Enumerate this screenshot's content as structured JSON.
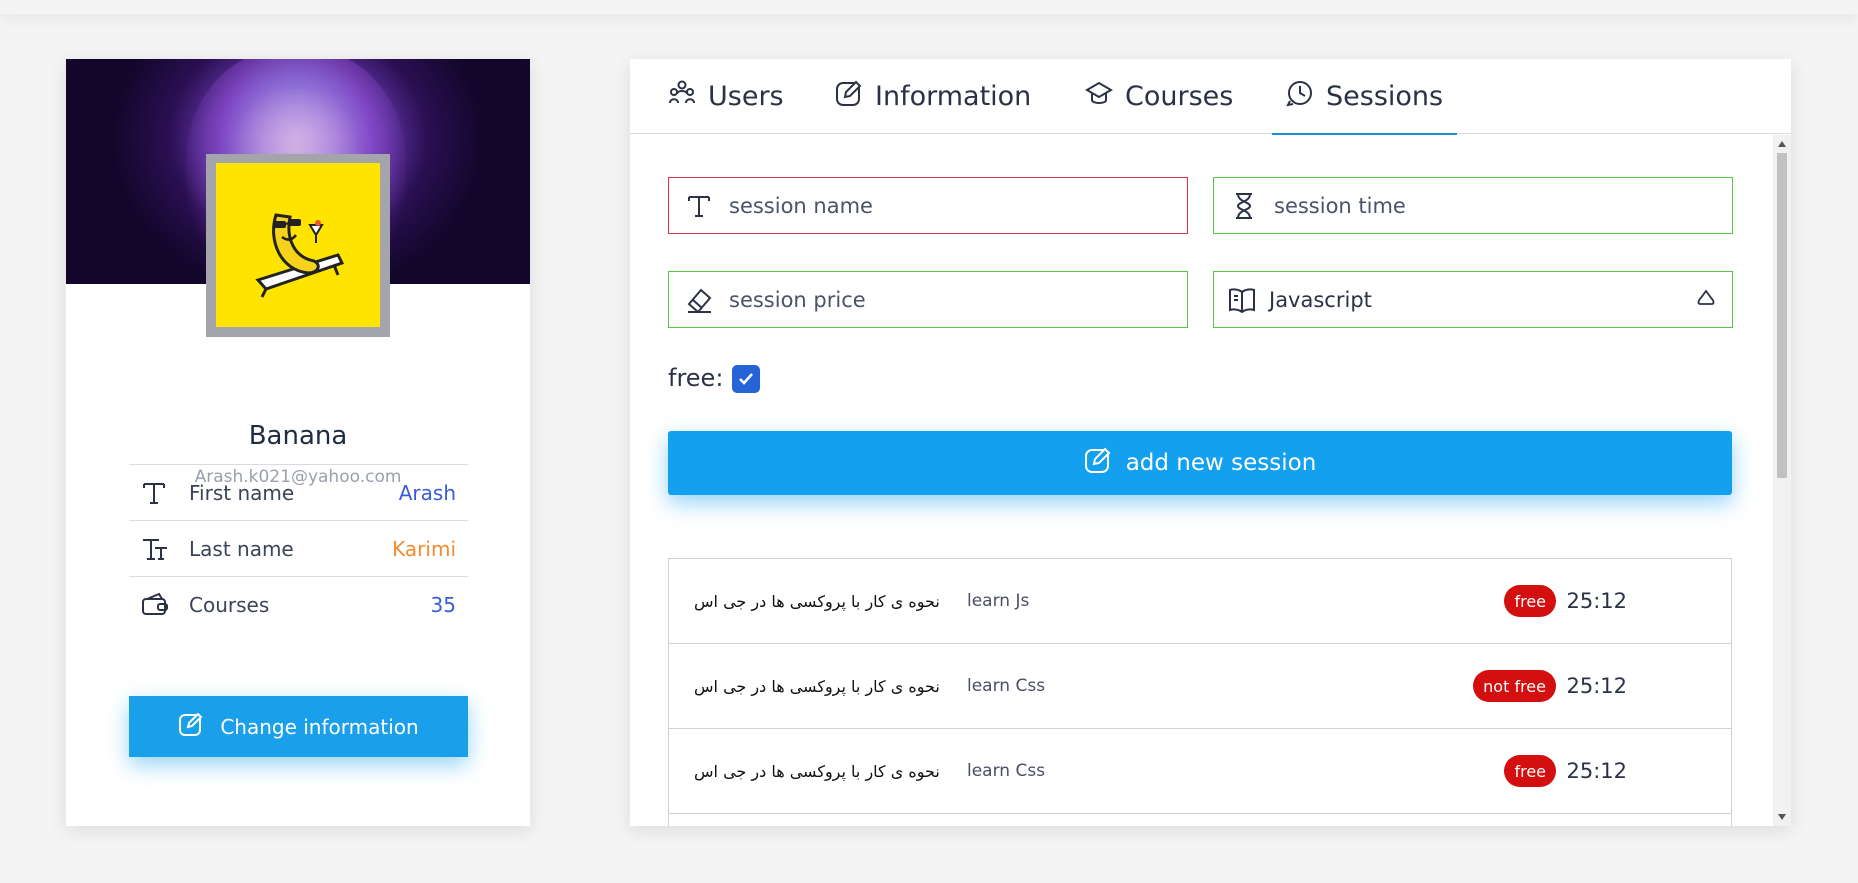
{
  "profile": {
    "name": "Banana",
    "email": "Arash.k021@yahoo.com",
    "fields": [
      {
        "icon": "text-icon",
        "label": "First name",
        "value": "Arash",
        "color": "#3b5bdb"
      },
      {
        "icon": "text-height-icon",
        "label": "Last name",
        "value": "Karimi",
        "color": "#f58b2e"
      },
      {
        "icon": "wallet-icon",
        "label": "Courses",
        "value": "35",
        "color": "#3b5bdb"
      }
    ],
    "change_button": "Change information"
  },
  "tabs": [
    {
      "icon": "users-icon",
      "label": "Users"
    },
    {
      "icon": "edit-icon",
      "label": "Information"
    },
    {
      "icon": "graduation-cap-icon",
      "label": "Courses"
    },
    {
      "icon": "session-icon",
      "label": "Sessions",
      "active": true
    }
  ],
  "form": {
    "session_name_placeholder": "session name",
    "session_time_placeholder": "session time",
    "session_price_placeholder": "session price",
    "course_select": "Javascript",
    "free_label": "free:",
    "free_checked": true,
    "add_button": "add new session"
  },
  "sessions": [
    {
      "title": "نحوه ی کار با پروکسی ها در جی اس",
      "course": "learn Js",
      "badge": "free",
      "time": "25:12"
    },
    {
      "title": "نحوه ی کار با پروکسی ها در جی اس",
      "course": "learn Css",
      "badge": "not free",
      "time": "25:12"
    },
    {
      "title": "نحوه ی کار با پروکسی ها در جی اس",
      "course": "learn Css",
      "badge": "free",
      "time": "25:12"
    }
  ],
  "colors": {
    "primary": "#12a0ef",
    "badge_red": "#d40f0f",
    "valid_border": "#5cc34a",
    "error_border": "#e0334a",
    "avatar_bg": "#ffe400"
  }
}
